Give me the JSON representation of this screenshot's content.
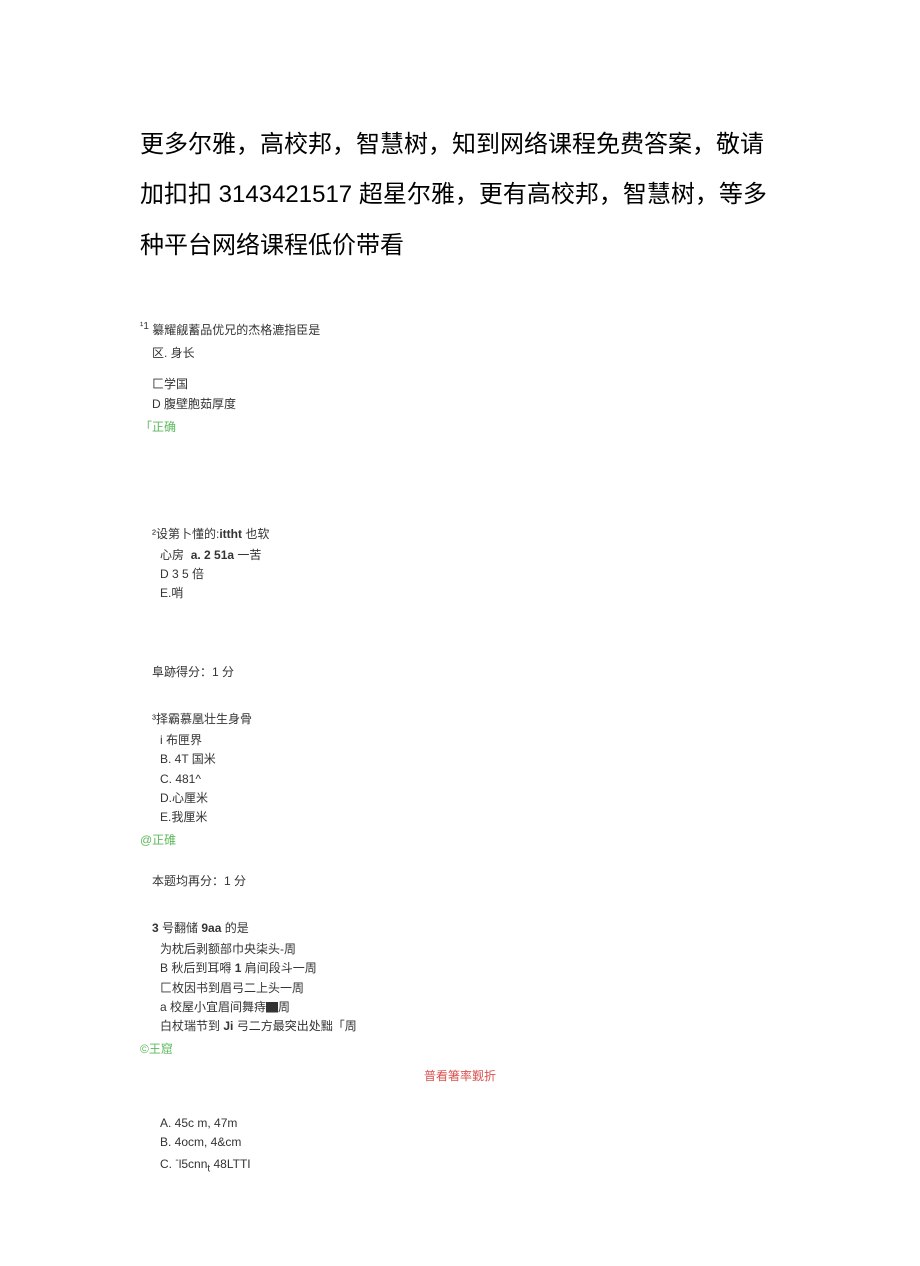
{
  "header": {
    "line1_prefix": "更多尔雅，高校邦，智慧树，知到网络课程免费答案，敬请加扣扣 ",
    "number": "3143421517",
    "line1_suffix": " 超星尔雅，更有高校邦，智慧树，等多种平台网络课程低价带看"
  },
  "q1": {
    "num": "¹1",
    "title": "纂耀觎蓄品优兄的杰格漉指臣是",
    "opt_a": "区. 身长",
    "opt_c": "匚学国",
    "opt_d": "D 腹壁胞茹厚度",
    "status": "「正确"
  },
  "q2": {
    "num": "²",
    "title_prefix": "设第卜懂的:",
    "title_bold": "ittht",
    "title_suffix": " 也软",
    "opt_heart": "心房",
    "opt_a_prefix": "a. 2 51a",
    "opt_a_suffix": " 一苦",
    "opt_d": "D 3 5 倍",
    "opt_e": "E.哨",
    "score": "阜跡得分：1 分"
  },
  "q3": {
    "num": "³",
    "title": "择霸慕凰壮生身骨",
    "opt_i": "i 布匣界",
    "opt_b": "B.  4T 国米",
    "opt_c": "C.  481^",
    "opt_d": "D.心厘米",
    "opt_e": "E.我厘米",
    "status": "@正碓",
    "score": "本题均再分：1 分"
  },
  "q4": {
    "num": "3",
    "title_prefix": " 号翻储 ",
    "title_bold": "9aa",
    "title_suffix": " 的是",
    "opt_a": "为枕后剥额部巾央柒头-周",
    "opt_b_prefix": "B 秋后到耳嘚 ",
    "opt_b_bold": "1",
    "opt_b_suffix": " 肩间段斗一周",
    "opt_c": "匚枚因书到眉弓二上头一周",
    "opt_d": "a 校屋小宜眉间舞痔▇周",
    "opt_e_prefix": "白杖瑞节到 ",
    "opt_e_bold": "Ji",
    "opt_e_suffix": " 弓二方最突出处黜「周",
    "status": "©王窟",
    "red_note": "普看箸率觐折"
  },
  "q5": {
    "opt_a": "A.  45c m, 47m",
    "opt_b": "B.  4ocm, 4&cm",
    "opt_c_prefix": "C.  ",
    "opt_c_sup": "-",
    "opt_c_mid": "l5cnn",
    "opt_c_sub": "t",
    "opt_c_suffix": " 48LTTI"
  }
}
